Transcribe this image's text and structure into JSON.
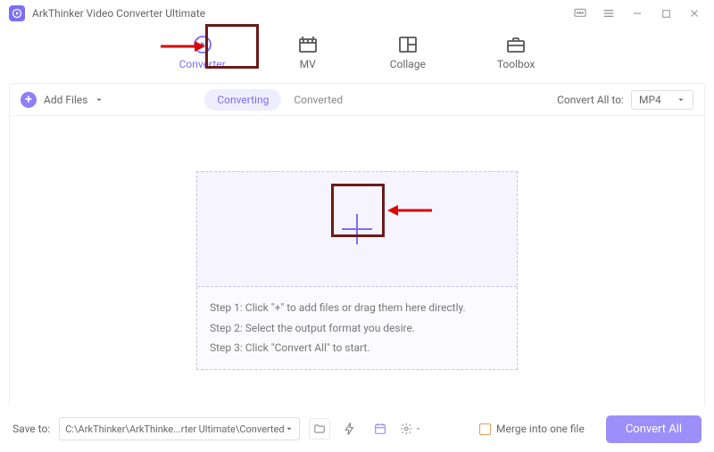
{
  "app": {
    "title": "ArkThinker Video Converter Ultimate"
  },
  "tabs": {
    "converter": "Converter",
    "mv": "MV",
    "collage": "Collage",
    "toolbox": "Toolbox"
  },
  "toolbar": {
    "add_files": "Add Files",
    "converting": "Converting",
    "converted": "Converted",
    "convert_all_to": "Convert All to:",
    "format": "MP4"
  },
  "steps": {
    "s1": "Step 1: Click \"+\" to add files or drag them here directly.",
    "s2": "Step 2: Select the output format you desire.",
    "s3": "Step 3: Click \"Convert All\" to start."
  },
  "footer": {
    "save_to": "Save to:",
    "path": "C:\\ArkThinker\\ArkThinke...rter Ultimate\\Converted",
    "merge": "Merge into one file",
    "convert_all": "Convert All"
  }
}
